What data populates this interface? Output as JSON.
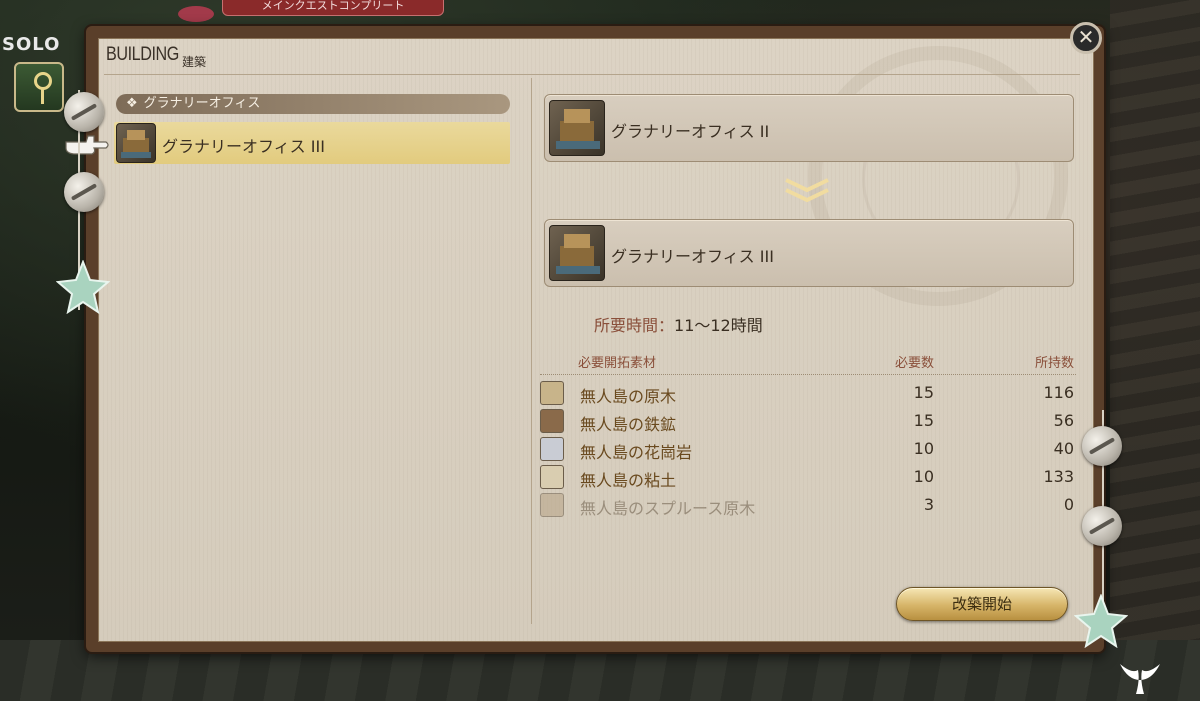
{
  "background": {
    "top_banner": "メインクエストコンプリート",
    "party_label": "SOLO"
  },
  "window": {
    "title_en": "BUILDING",
    "title_jp": "建築",
    "close_icon": "close-x-icon"
  },
  "left_list": {
    "category": "グラナリーオフィス",
    "category_icon": "diamond-bullet-icon",
    "items": [
      {
        "label": "グラナリーオフィス III",
        "selected": true,
        "icon": "granary-building-icon"
      }
    ]
  },
  "upgrade": {
    "from_label": "グラナリーオフィス II",
    "to_label": "グラナリーオフィス III",
    "arrow_icon": "double-chevron-down-icon"
  },
  "time": {
    "label": "所要時間：",
    "value": "11～12時間"
  },
  "materials": {
    "headers": {
      "name": "必要開拓素材",
      "required": "必要数",
      "owned": "所持数"
    },
    "rows": [
      {
        "name": "無人島の原木",
        "required": "15",
        "owned": "116",
        "icon": "log-icon",
        "color": "#c8b48a",
        "available": true
      },
      {
        "name": "無人島の鉄鉱",
        "required": "15",
        "owned": "56",
        "icon": "iron-ore-icon",
        "color": "#8a6a4a",
        "available": true
      },
      {
        "name": "無人島の花崗岩",
        "required": "10",
        "owned": "40",
        "icon": "granite-icon",
        "color": "#c9ccd4",
        "available": true
      },
      {
        "name": "無人島の粘土",
        "required": "10",
        "owned": "133",
        "icon": "clay-icon",
        "color": "#d9cdb0",
        "available": true
      },
      {
        "name": "無人島のスプルース原木",
        "required": "3",
        "owned": "0",
        "icon": "spruce-log-icon",
        "color": "#b8a486",
        "available": false
      }
    ]
  },
  "actions": {
    "start_label": "改築開始"
  }
}
